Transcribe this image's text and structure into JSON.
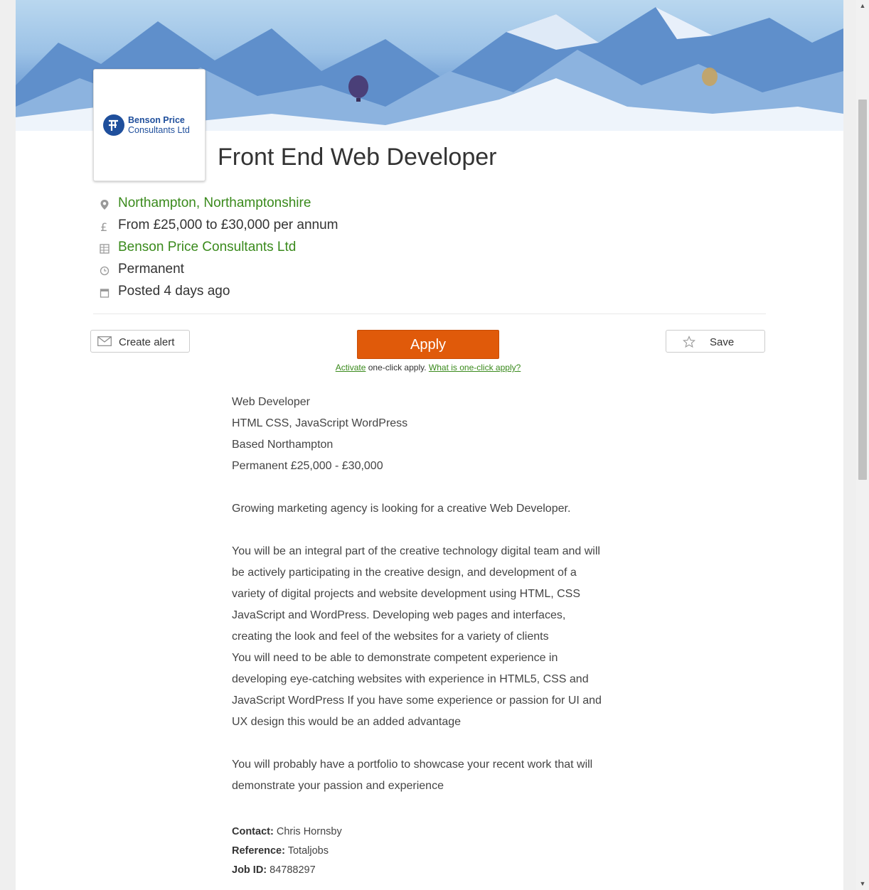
{
  "job": {
    "title": "Front End Web Developer",
    "location": "Northampton, Northamptonshire",
    "salary": "From £25,000 to £30,000 per annum",
    "company": "Benson Price Consultants Ltd",
    "type": "Permanent",
    "posted": "Posted 4 days ago"
  },
  "logo": {
    "line1": "Benson Price",
    "line2": "Consultants Ltd",
    "brand_color": "#1f4f9c"
  },
  "actions": {
    "create_alert": "Create alert",
    "apply": "Apply",
    "save": "Save",
    "activate_link": "Activate",
    "oneclick_text": " one-click apply. ",
    "what_is_link": "What is one-click apply?"
  },
  "description": {
    "lines_block1": [
      " Web Developer",
      "HTML CSS, JavaScript WordPress",
      "Based Northampton",
      "Permanent £25,000 - £30,000"
    ],
    "para1": "Growing marketing agency is looking for a creative Web Developer.",
    "para2_lines": [
      "You will be an integral part of the creative technology digital team and will",
      "be actively participating in the creative design, and development of a",
      "variety of digital projects and website development using HTML, CSS",
      "JavaScript and WordPress. Developing web pages and interfaces,",
      "creating the look and feel of the websites for a variety of clients",
      "You will need to be able to demonstrate competent experience in",
      "developing eye-catching websites with experience in HTML5, CSS and",
      "JavaScript WordPress If you have some experience or passion for UI and",
      "UX design this would be an added advantage"
    ],
    "para3_lines": [
      "You will probably have a portfolio to showcase your recent work that will",
      "demonstrate your passion and experience"
    ]
  },
  "meta": {
    "contact_label": "Contact:",
    "contact_value": " Chris Hornsby",
    "reference_label": "Reference:",
    "reference_value": " Totaljobs",
    "jobid_label": "Job ID:",
    "jobid_value": " 84788297"
  },
  "colors": {
    "accent_orange": "#e05a0a",
    "link_green": "#3a8a1c"
  },
  "icons": {
    "location": "map-pin-icon",
    "salary": "pound-icon",
    "company": "building-icon",
    "type": "clock-icon",
    "posted": "calendar-icon",
    "alert": "envelope-icon",
    "save": "star-icon"
  }
}
